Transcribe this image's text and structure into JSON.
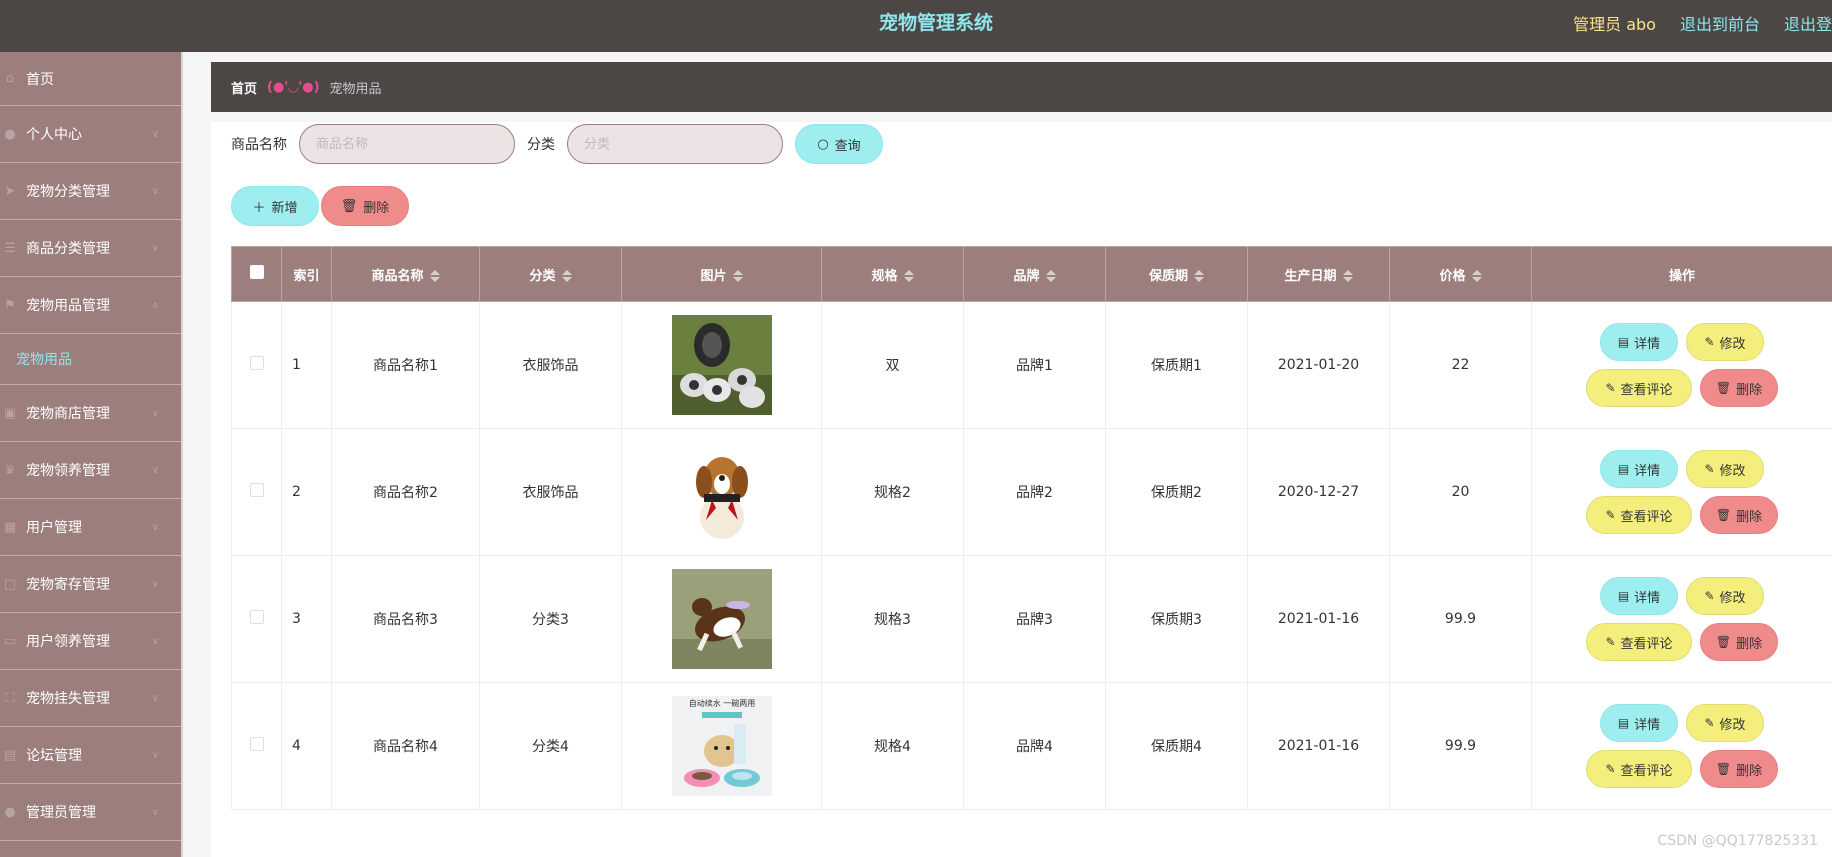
{
  "header": {
    "title": "宠物管理系统",
    "admin": "管理员 abo",
    "exit_front": "退出到前台",
    "exit_login": "退出登"
  },
  "sidebar": {
    "items": [
      {
        "label": "首页",
        "icon": "home-icon",
        "chev": ""
      },
      {
        "label": "个人中心",
        "icon": "user-icon",
        "chev": "∨"
      },
      {
        "label": "宠物分类管理",
        "icon": "send-icon",
        "chev": "∨"
      },
      {
        "label": "商品分类管理",
        "icon": "list-icon",
        "chev": "∨"
      },
      {
        "label": "宠物用品管理",
        "icon": "flag-icon",
        "chev": "∧"
      },
      {
        "label": "宠物商店管理",
        "icon": "shop-icon",
        "chev": "∨"
      },
      {
        "label": "宠物领养管理",
        "icon": "trophy-icon",
        "chev": "∨"
      },
      {
        "label": "用户管理",
        "icon": "chart-icon",
        "chev": "∨"
      },
      {
        "label": "宠物寄存管理",
        "icon": "box-icon",
        "chev": "∨"
      },
      {
        "label": "用户领养管理",
        "icon": "card-icon",
        "chev": "∨"
      },
      {
        "label": "宠物挂失管理",
        "icon": "scan-icon",
        "chev": "∨"
      },
      {
        "label": "论坛管理",
        "icon": "doc-icon",
        "chev": "∨"
      },
      {
        "label": "管理员管理",
        "icon": "user-icon",
        "chev": "∨"
      }
    ],
    "sub_item": "宠物用品"
  },
  "breadcrumb": {
    "home": "首页",
    "sep": "(●'◡'●)",
    "current": "宠物用品"
  },
  "search": {
    "name_label": "商品名称",
    "name_placeholder": "商品名称",
    "category_label": "分类",
    "category_placeholder": "分类",
    "query_label": "查询"
  },
  "actions": {
    "add_label": "新增",
    "delete_label": "删除"
  },
  "table": {
    "headers": {
      "index": "索引",
      "name": "商品名称",
      "category": "分类",
      "image": "图片",
      "spec": "规格",
      "brand": "品牌",
      "shelf": "保质期",
      "date": "生产日期",
      "price": "价格",
      "ops": "操作"
    },
    "row_buttons": {
      "detail": "详情",
      "edit": "修改",
      "review": "查看评论",
      "delete": "删除"
    },
    "rows": [
      {
        "index": "1",
        "name": "商品名称1",
        "category": "衣服饰品",
        "spec": "双",
        "brand": "品牌1",
        "shelf": "保质期1",
        "date": "2021-01-20",
        "price": "22"
      },
      {
        "index": "2",
        "name": "商品名称2",
        "category": "衣服饰品",
        "spec": "规格2",
        "brand": "品牌2",
        "shelf": "保质期2",
        "date": "2020-12-27",
        "price": "20"
      },
      {
        "index": "3",
        "name": "商品名称3",
        "category": "分类3",
        "spec": "规格3",
        "brand": "品牌3",
        "shelf": "保质期3",
        "date": "2021-01-16",
        "price": "99.9"
      },
      {
        "index": "4",
        "name": "商品名称4",
        "category": "分类4",
        "spec": "规格4",
        "brand": "品牌4",
        "shelf": "保质期4",
        "date": "2021-01-16",
        "price": "99.9"
      }
    ],
    "thumb4_text": "自动续水 一碗两用"
  },
  "watermark": "CSDN @QQ177825331",
  "colors": {
    "header_bg": "#4c4645",
    "sidebar_bg": "#9c7f7d",
    "accent_cyan": "#9eeeef",
    "accent_yellow": "#f4ef7d",
    "accent_red": "#f08b8c"
  }
}
